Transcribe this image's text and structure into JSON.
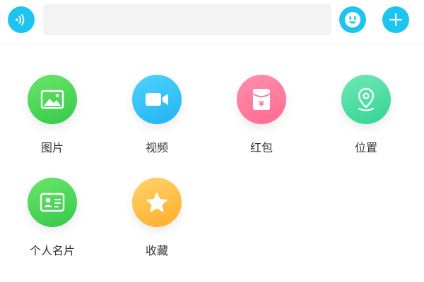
{
  "input": {
    "value": "",
    "placeholder": ""
  },
  "top_buttons": {
    "voice_icon": "voice-wave-icon",
    "emoji_icon": "emoji-face-icon",
    "plus_icon": "plus-icon",
    "color": "#1ec4f0"
  },
  "panel": {
    "items": [
      {
        "label": "图片",
        "icon": "image-icon",
        "color": "#3fd15a"
      },
      {
        "label": "视频",
        "icon": "video-camera-icon",
        "color": "#2bbaf5"
      },
      {
        "label": "红包",
        "icon": "red-envelope-icon",
        "color": "#ff7598"
      },
      {
        "label": "位置",
        "icon": "location-pin-icon",
        "color": "#45db9f"
      },
      {
        "label": "个人名片",
        "icon": "contact-card-icon",
        "color": "#3fd15a"
      },
      {
        "label": "收藏",
        "icon": "star-icon",
        "color": "#ffbb3a"
      }
    ]
  }
}
